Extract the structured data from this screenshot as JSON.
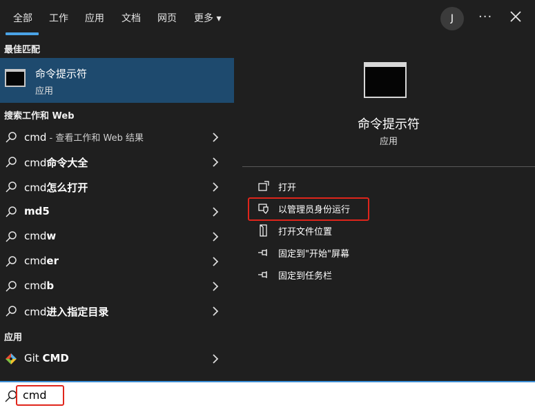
{
  "tabs": [
    {
      "label": "全部",
      "active": true
    },
    {
      "label": "工作"
    },
    {
      "label": "应用"
    },
    {
      "label": "文档"
    },
    {
      "label": "网页"
    },
    {
      "label": "更多 ▾"
    }
  ],
  "user_initial": "J",
  "more_label": "···",
  "left": {
    "best_match_header": "最佳匹配",
    "best_match": {
      "title": "命令提示符",
      "subtitle": "应用",
      "icon": "terminal-icon"
    },
    "web_header": "搜索工作和 Web",
    "web_results": [
      {
        "prefix": "cmd",
        "bold": "",
        "sub": " - 查看工作和 Web 结果"
      },
      {
        "prefix": "cmd",
        "bold": "命令大全",
        "sub": ""
      },
      {
        "prefix": "cmd",
        "bold": "怎么打开",
        "sub": ""
      },
      {
        "prefix": "",
        "bold": "md5",
        "sub": ""
      },
      {
        "prefix": "cmd",
        "bold": "w",
        "sub": ""
      },
      {
        "prefix": "cmd",
        "bold": "er",
        "sub": ""
      },
      {
        "prefix": "cmd",
        "bold": "b",
        "sub": ""
      },
      {
        "prefix": "cmd",
        "bold": "进入指定目录",
        "sub": ""
      }
    ],
    "apps_header": "应用",
    "apps": [
      {
        "prefix": "Git ",
        "bold": "CMD",
        "icon": "git-icon"
      }
    ]
  },
  "right": {
    "title": "命令提示符",
    "subtitle": "应用",
    "actions": [
      {
        "label": "打开",
        "icon": "open-icon"
      },
      {
        "label": "以管理员身份运行",
        "icon": "shield-icon"
      },
      {
        "label": "打开文件位置",
        "icon": "folder-icon"
      },
      {
        "label": "固定到\"开始\"屏幕",
        "icon": "pin-icon"
      },
      {
        "label": "固定到任务栏",
        "icon": "pin-icon"
      }
    ]
  },
  "search": {
    "value": "cmd"
  },
  "colors": {
    "accent": "#4aa3e6",
    "selected": "#1e4a6e",
    "highlight_box": "#e0251b",
    "background": "#1f1f1f"
  }
}
